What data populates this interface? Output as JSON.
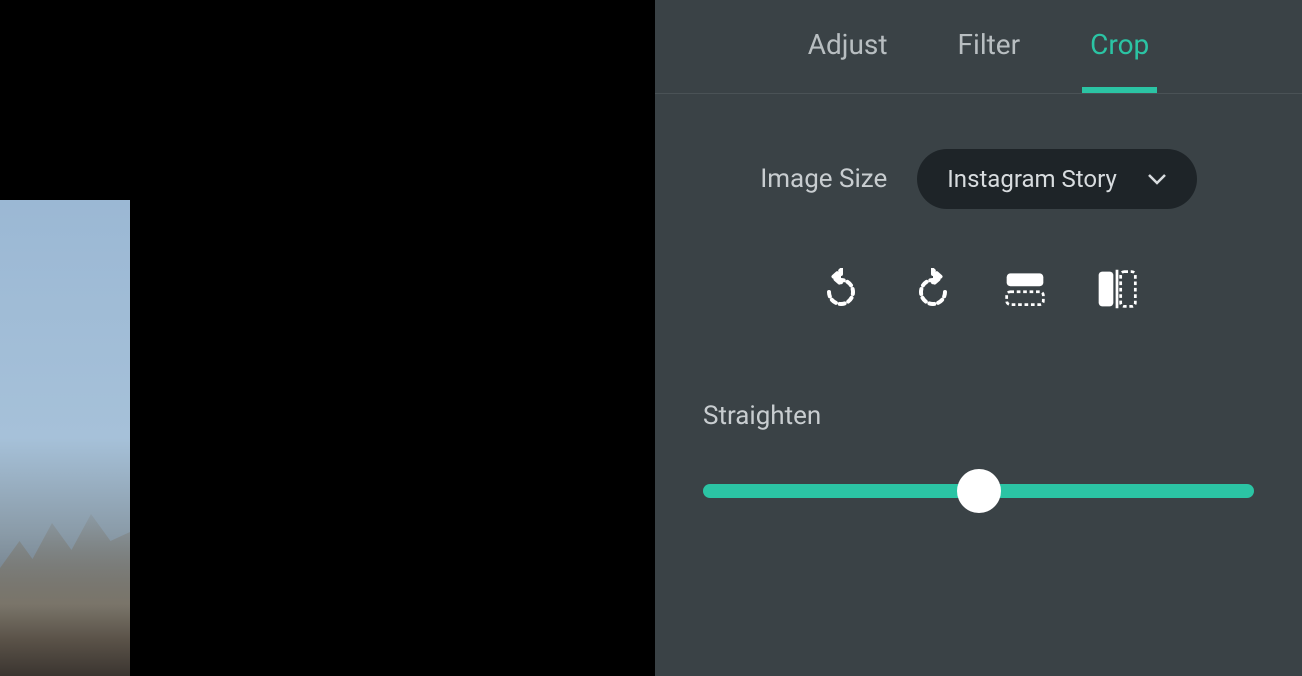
{
  "tabs": {
    "adjust": "Adjust",
    "filter": "Filter",
    "crop": "Crop",
    "active": "crop"
  },
  "imageSize": {
    "label": "Image Size",
    "value": "Instagram Story"
  },
  "transforms": {
    "rotateLeft": "rotate-left-icon",
    "rotateRight": "rotate-right-icon",
    "flipHorizontal": "flip-horizontal-icon",
    "flipVertical": "flip-vertical-icon"
  },
  "straighten": {
    "label": "Straighten",
    "value": 50,
    "min": 0,
    "max": 100
  },
  "colors": {
    "accent": "#2bc4a4",
    "panelBg": "#3a4246",
    "dropdownBg": "#1e2428",
    "textMuted": "#b8bec1",
    "textLight": "#c8cdd0"
  }
}
